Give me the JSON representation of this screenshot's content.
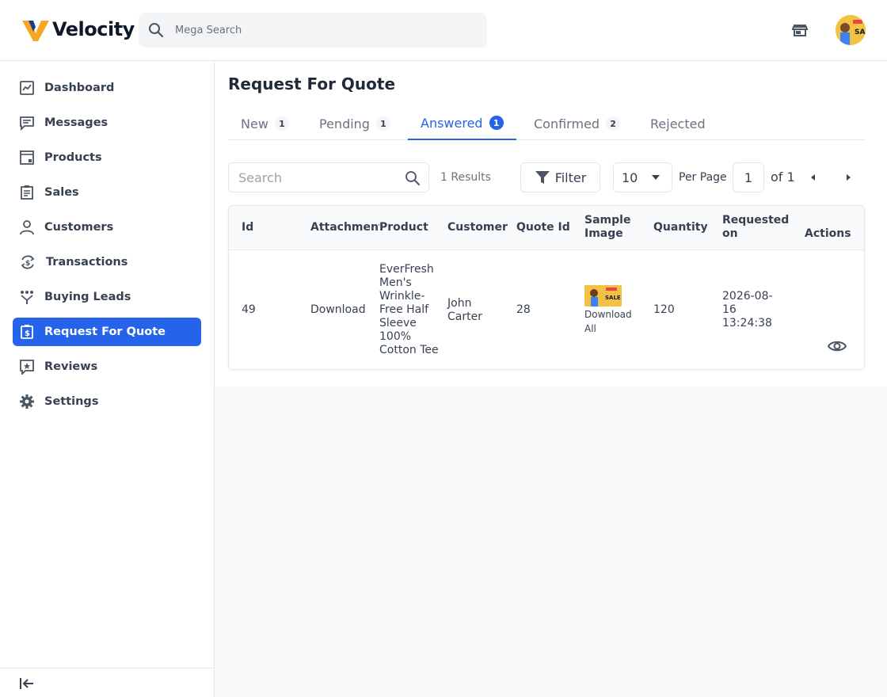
{
  "brand": {
    "name": "Velocity",
    "accent": "#2563eb",
    "logo_color": "#f6a623"
  },
  "header": {
    "search_placeholder": "Mega Search",
    "icons": [
      "search-icon",
      "store-icon",
      "avatar"
    ]
  },
  "sidebar": {
    "items": [
      {
        "label": "Dashboard",
        "icon": "dashboard-icon"
      },
      {
        "label": "Messages",
        "icon": "message-icon"
      },
      {
        "label": "Products",
        "icon": "products-icon"
      },
      {
        "label": "Sales",
        "icon": "sales-icon"
      },
      {
        "label": "Customers",
        "icon": "customers-icon"
      },
      {
        "label": "Transactions",
        "icon": "transactions-icon"
      },
      {
        "label": "Buying Leads",
        "icon": "buying-leads-icon"
      },
      {
        "label": "Request For Quote",
        "icon": "quote-icon",
        "active": true
      },
      {
        "label": "Reviews",
        "icon": "reviews-icon"
      },
      {
        "label": "Settings",
        "icon": "gear-icon"
      }
    ],
    "footer_icon": "collapse-icon"
  },
  "page": {
    "title": "Request For Quote",
    "tabs": [
      {
        "label": "New",
        "count": "1"
      },
      {
        "label": "Pending",
        "count": "1"
      },
      {
        "label": "Answered",
        "count": "1",
        "active": true
      },
      {
        "label": "Confirmed",
        "count": "2"
      },
      {
        "label": "Rejected"
      }
    ]
  },
  "toolbar": {
    "search_placeholder": "Search",
    "results": "1 Results",
    "filter_label": "Filter",
    "per_page_value": "10",
    "per_page_label": "Per Page",
    "page_current": "1",
    "page_of": "of 1"
  },
  "table": {
    "headers": {
      "id": "Id",
      "attachment": "Attachment",
      "product": "Product",
      "customer": "Customer",
      "quote_id": "Quote Id",
      "sample_image_1": "Sample",
      "sample_image_2": "Image",
      "quantity": "Quantity",
      "requested_on_1": "Requested",
      "requested_on_2": "on",
      "actions": "Actions"
    },
    "rows": [
      {
        "id": "49",
        "attachment": "Download",
        "product_lines": [
          "EverFresh",
          "Men's",
          "Wrinkle-",
          "Free Half",
          "Sleeve",
          "100%",
          "Cotton Tee"
        ],
        "customer_lines": [
          "John",
          "Carter"
        ],
        "quote_id": "28",
        "sample_image_caption_lines": [
          "Download",
          "All"
        ],
        "sample_image_text": "SALE",
        "quantity": "120",
        "requested_on_lines": [
          "2026-08-",
          "16",
          "13:24:38"
        ],
        "action_icon": "eye-icon"
      }
    ]
  }
}
